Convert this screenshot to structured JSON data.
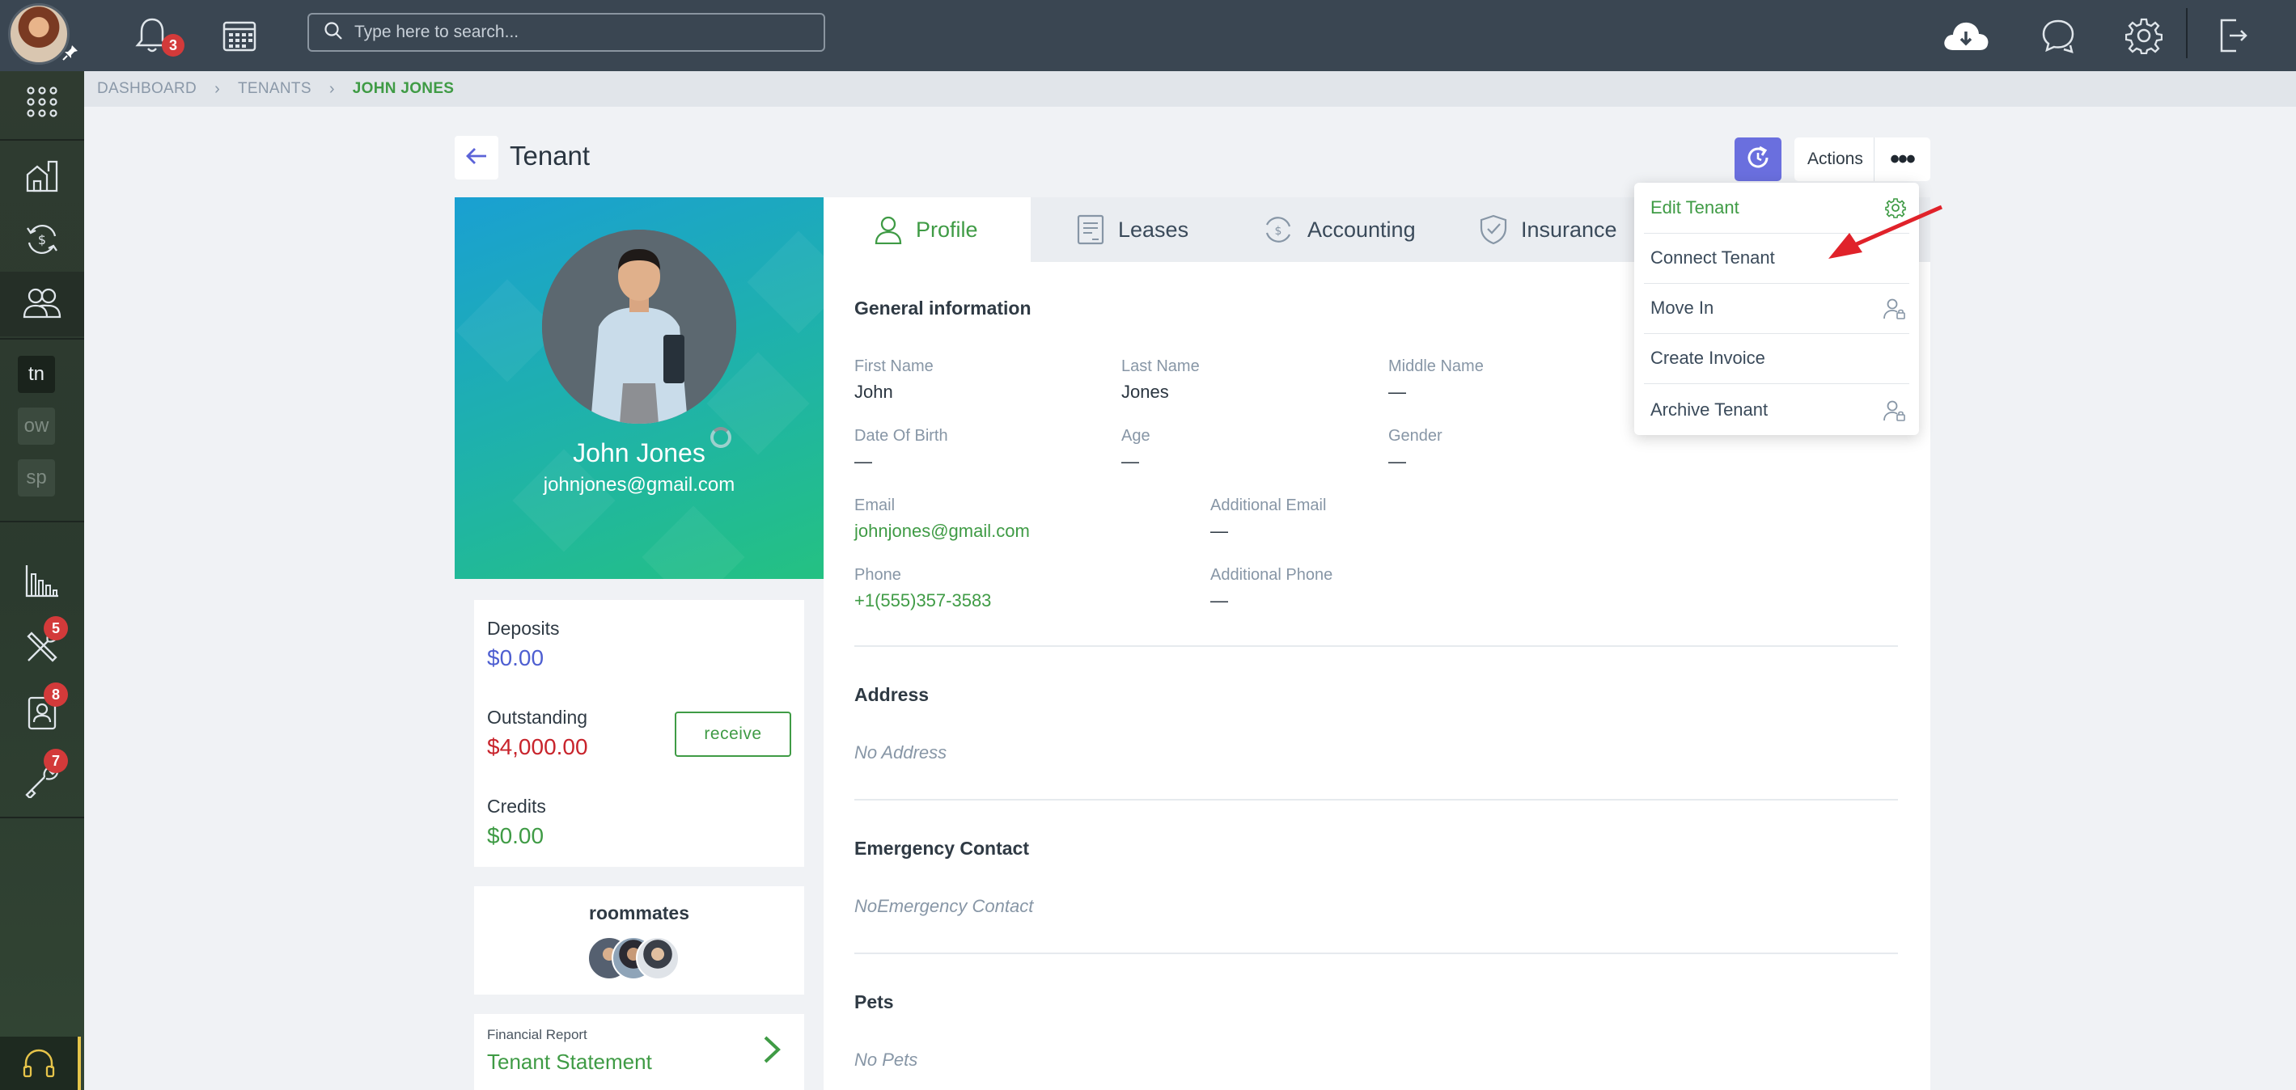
{
  "topbar": {
    "notifications_badge": "3",
    "search_placeholder": "Type here to search..."
  },
  "sidebar": {
    "tags": [
      "tn",
      "ow",
      "sp"
    ],
    "badges": {
      "maintenance": "5",
      "contacts": "8",
      "tools": "7"
    }
  },
  "breadcrumb": [
    "DASHBOARD",
    "TENANTS",
    "JOHN JONES"
  ],
  "header": {
    "title": "Tenant",
    "actions_label": "Actions",
    "more_label": "•••"
  },
  "profile": {
    "name": "John Jones",
    "email": "johnjones@gmail.com"
  },
  "balances": {
    "deposits_label": "Deposits",
    "deposits_value": "$0.00",
    "outstanding_label": "Outstanding",
    "outstanding_value": "$4,000.00",
    "receive_label": "receive",
    "credits_label": "Credits",
    "credits_value": "$0.00"
  },
  "roommates": {
    "title": "roommates"
  },
  "financial": {
    "small": "Financial Report",
    "big": "Tenant Statement"
  },
  "tabs": [
    "Profile",
    "Leases",
    "Accounting",
    "Insurance"
  ],
  "general": {
    "title": "General information",
    "first_name_label": "First Name",
    "first_name": "John",
    "last_name_label": "Last Name",
    "last_name": "Jones",
    "middle_name_label": "Middle Name",
    "middle_name": "—",
    "dob_label": "Date Of Birth",
    "dob": "—",
    "age_label": "Age",
    "age": "—",
    "gender_label": "Gender",
    "gender": "—",
    "email_label": "Email",
    "email": "johnjones@gmail.com",
    "add_email_label": "Additional Email",
    "add_email": "—",
    "phone_label": "Phone",
    "phone": "+1(555)357-3583",
    "add_phone_label": "Additional Phone",
    "add_phone": "—"
  },
  "address": {
    "title": "Address",
    "empty": "No Address"
  },
  "emergency": {
    "title": "Emergency Contact",
    "empty": "NoEmergency Contact"
  },
  "pets": {
    "title": "Pets",
    "empty": "No Pets"
  },
  "dropdown": [
    "Edit Tenant",
    "Connect Tenant",
    "Move In",
    "Create Invoice",
    "Archive Tenant"
  ],
  "colors": {
    "accent_green": "#3f9b45",
    "accent_purple": "#6a6fde",
    "danger_red": "#c8242c",
    "deposit_blue": "#4e5fd1"
  }
}
